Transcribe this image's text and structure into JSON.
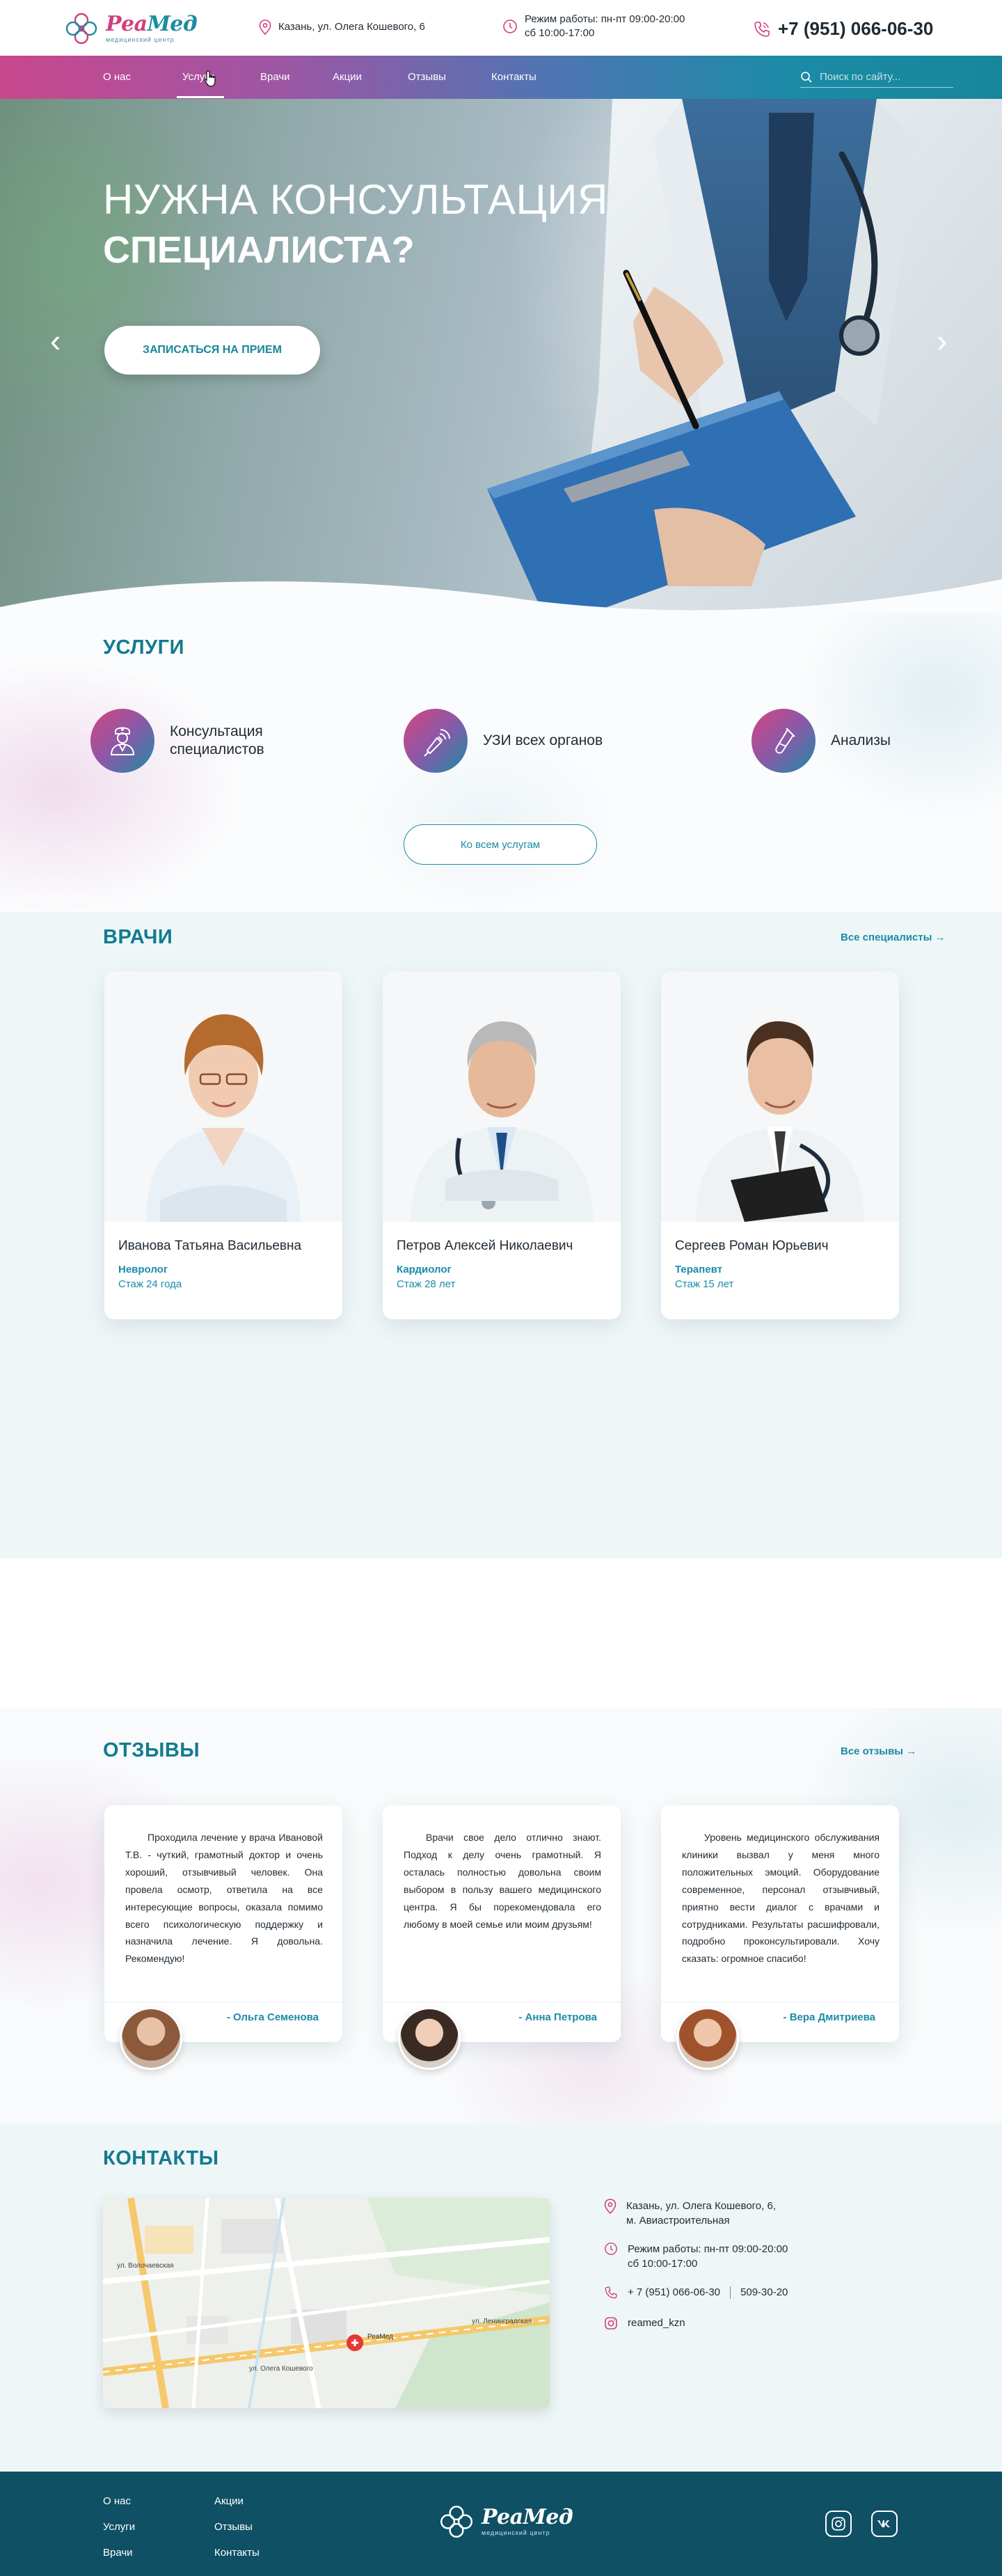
{
  "brand": {
    "name_part1": "Реа",
    "name_part2": "Мед",
    "subtitle": "медицинский центр"
  },
  "header": {
    "address": "Казань, ул. Олега Кошевого, 6",
    "hours_line1": "Режим работы: пн-пт 09:00-20:00",
    "hours_line2": "сб 10:00-17:00",
    "phone": "+7 (951) 066-06-30"
  },
  "nav": {
    "items": [
      {
        "label": "О нас"
      },
      {
        "label": "Услуги"
      },
      {
        "label": "Врачи"
      },
      {
        "label": "Акции"
      },
      {
        "label": "Отзывы"
      },
      {
        "label": "Контакты"
      }
    ],
    "active": "Услуги",
    "search_placeholder": "Поиск по сайту..."
  },
  "hero": {
    "title_line1": "НУЖНА КОНСУЛЬТАЦИЯ",
    "title_line2": "СПЕЦИАЛИСТА?",
    "cta": "ЗАПИСАТЬСЯ НА ПРИЕМ",
    "prev": "‹",
    "next": "›"
  },
  "services": {
    "title": "УСЛУГИ",
    "items": [
      {
        "label": "Консультация специалистов",
        "icon": "doctor-icon"
      },
      {
        "label": "УЗИ всех органов",
        "icon": "ultrasound-icon"
      },
      {
        "label": "Анализы",
        "icon": "test-tube-icon"
      }
    ],
    "all_button": "Ко всем услугам"
  },
  "doctors": {
    "title": "ВРАЧИ",
    "all_link": "Все специалисты →",
    "items": [
      {
        "name": "Иванова Татьяна Васильевна",
        "specialty": "Невролог",
        "experience": "Стаж 24 года"
      },
      {
        "name": "Петров Алексей Николаевич",
        "specialty": "Кардиолог",
        "experience": "Стаж 28 лет"
      },
      {
        "name": "Сергеев Роман Юрьевич",
        "specialty": "Терапевт",
        "experience": "Стаж 15 лет"
      }
    ]
  },
  "reviews": {
    "title": "ОТЗЫВЫ",
    "all_link": "Все отзывы →",
    "items": [
      {
        "text": "Проходила лечение у врача Ивановой Т.В. - чуткий, грамотный доктор и очень хороший, отзывчивый человек. Она провела осмотр, ответила на все интересующие вопросы, оказала помимо всего психологическую поддержку и назначила лечение. Я довольна. Рекомендую!",
        "author": "- Ольга Семенова"
      },
      {
        "text": "Врачи свое дело отлично знают. Подход к делу очень грамотный. Я осталась полностью довольна своим выбором в пользу вашего медицинского центра. Я бы порекомендовала его любому в моей семье или моим друзьям!",
        "author": "- Анна Петрова"
      },
      {
        "text": "Уровень медицинского обслуживания клиники вызвал у меня много положительных эмоций. Оборудование современное, персонал отзывчивый, приятно вести диалог с врачами и сотрудниками. Результаты расшифровали, подробно проконсультировали. Хочу сказать: огромное спасибо!",
        "author": "- Вера Дмитриева"
      }
    ]
  },
  "contacts": {
    "title": "КОНТАКТЫ",
    "address_line1": "Казань, ул. Олега Кошевого, 6,",
    "address_line2": "м. Авиастроительная",
    "hours_line1": "Режим работы: пн-пт 09:00-20:00",
    "hours_line2": "сб 10:00-17:00",
    "phone1": "+ 7 (951) 066-06-30",
    "phone2": "509-30-20",
    "instagram": "reamed_kzn",
    "map_marker_label": "РеаМед",
    "map_street1": "ул. Олега Кошевого",
    "map_street2": "ул. Ленинградская",
    "map_street3": "ул. Волочаевская"
  },
  "footer": {
    "col1": [
      "О нас",
      "Услуги",
      "Врачи"
    ],
    "col2": [
      "Акции",
      "Отзывы",
      "Контакты"
    ],
    "social": [
      "instagram-icon",
      "vk-icon"
    ]
  },
  "colors": {
    "teal": "#1a8ca5",
    "pink": "#d1407e",
    "footer": "#0f5064"
  }
}
